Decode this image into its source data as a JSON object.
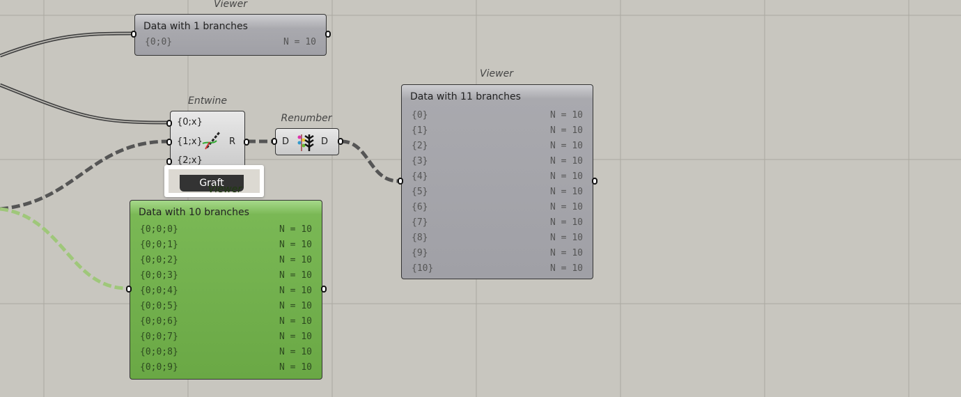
{
  "viewer_top": {
    "label": "Viewer",
    "title": "Data with 1 branches",
    "rows": [
      {
        "path": "{0;0}",
        "n": "N = 10"
      }
    ]
  },
  "entwine": {
    "label": "Entwine",
    "inputs": [
      "{0;x}",
      "{1;x}",
      "{2;x}"
    ],
    "output": "R"
  },
  "renumber": {
    "label": "Renumber",
    "input": "D",
    "output": "D"
  },
  "tooltip": {
    "text": "Graft"
  },
  "viewer_green": {
    "label": "Viewer",
    "title": "Data with 10 branches",
    "rows": [
      {
        "path": "{0;0;0}",
        "n": "N = 10"
      },
      {
        "path": "{0;0;1}",
        "n": "N = 10"
      },
      {
        "path": "{0;0;2}",
        "n": "N = 10"
      },
      {
        "path": "{0;0;3}",
        "n": "N = 10"
      },
      {
        "path": "{0;0;4}",
        "n": "N = 10"
      },
      {
        "path": "{0;0;5}",
        "n": "N = 10"
      },
      {
        "path": "{0;0;6}",
        "n": "N = 10"
      },
      {
        "path": "{0;0;7}",
        "n": "N = 10"
      },
      {
        "path": "{0;0;8}",
        "n": "N = 10"
      },
      {
        "path": "{0;0;9}",
        "n": "N = 10"
      }
    ]
  },
  "viewer_right": {
    "label": "Viewer",
    "title": "Data with 11 branches",
    "rows": [
      {
        "path": "{0}",
        "n": "N = 10"
      },
      {
        "path": "{1}",
        "n": "N = 10"
      },
      {
        "path": "{2}",
        "n": "N = 10"
      },
      {
        "path": "{3}",
        "n": "N = 10"
      },
      {
        "path": "{4}",
        "n": "N = 10"
      },
      {
        "path": "{5}",
        "n": "N = 10"
      },
      {
        "path": "{6}",
        "n": "N = 10"
      },
      {
        "path": "{7}",
        "n": "N = 10"
      },
      {
        "path": "{8}",
        "n": "N = 10"
      },
      {
        "path": "{9}",
        "n": "N = 10"
      },
      {
        "path": "{10}",
        "n": "N = 10"
      }
    ]
  }
}
